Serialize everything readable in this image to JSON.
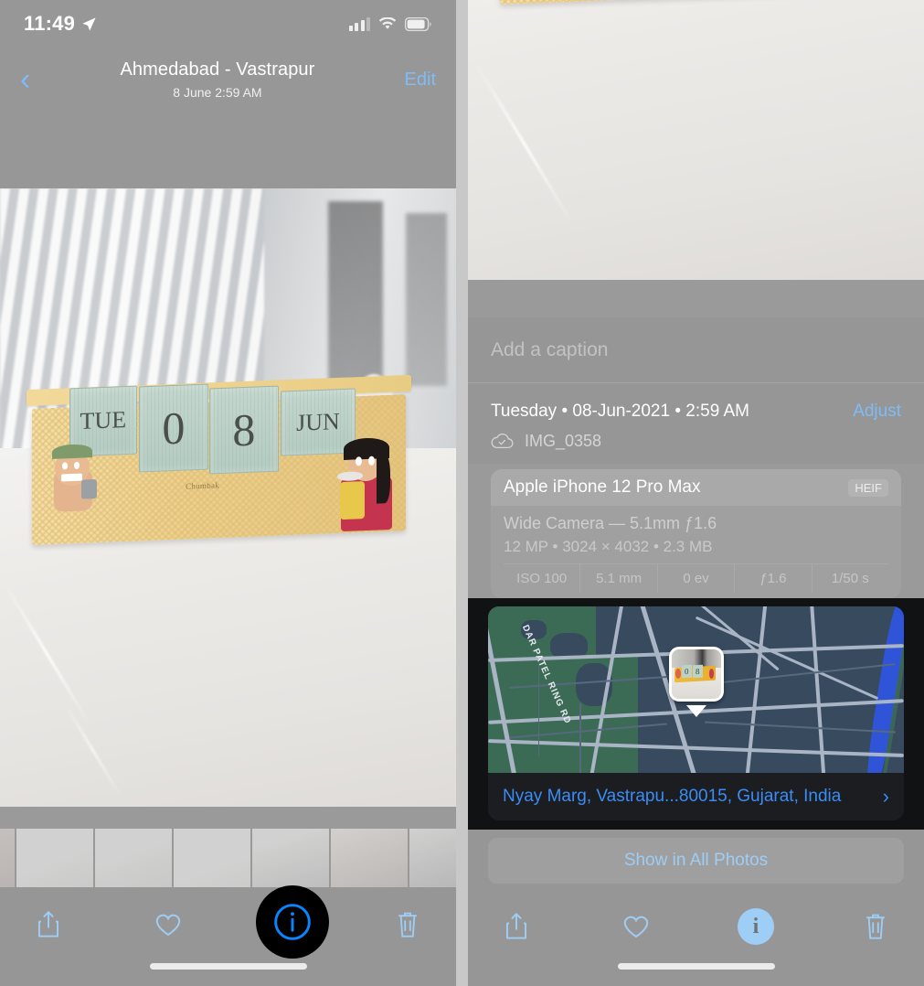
{
  "left": {
    "status": {
      "time": "11:49",
      "location_arrow": "location-arrow-icon",
      "signal": "cellular-signal-icon",
      "wifi": "wifi-icon",
      "battery": "battery-icon"
    },
    "nav": {
      "back": "chevron-left-icon",
      "title": "Ahmedabad - Vastrapur",
      "subtitle": "8 June  2:59 AM",
      "edit_label": "Edit"
    },
    "toolbar": {
      "share": "share-icon",
      "favorite": "heart-icon",
      "info": "info-icon",
      "delete": "trash-icon"
    },
    "photo": {
      "day": "TUE",
      "digit1": "0",
      "digit2": "8",
      "month": "JUN",
      "brand": "Chumbak"
    }
  },
  "right": {
    "caption": {
      "placeholder": "Add a caption",
      "value": ""
    },
    "meta": {
      "date_line": "Tuesday • 08-Jun-2021 • 2:59 AM",
      "adjust_label": "Adjust",
      "cloud_icon": "cloud-check-icon",
      "filename": "IMG_0358"
    },
    "exif": {
      "device": "Apple iPhone 12 Pro Max",
      "format": "HEIF",
      "lens_line": "Wide Camera — 5.1mm ƒ1.6",
      "size_line": "12 MP • 3024 × 4032 • 2.3 MB",
      "stats": [
        "ISO 100",
        "5.1 mm",
        "0 ev",
        "ƒ1.6",
        "1/50 s"
      ]
    },
    "map": {
      "road_label": "DAR PATEL RING RD",
      "address": "Nyay Marg, Vastrapu...80015, Gujarat, India",
      "chevron": "chevron-right-icon",
      "pin": "photo-pin-icon"
    },
    "show_all_label": "Show in All Photos",
    "toolbar": {
      "share": "share-icon",
      "favorite": "heart-icon",
      "info": "info-icon",
      "delete": "trash-icon"
    }
  },
  "colors": {
    "accent_blue": "#7fbcf5",
    "link_blue": "#3b8cf5",
    "overlay_gray": "#969696",
    "map_green": "#3b6b55",
    "map_blue_gray": "#374a5e",
    "river_blue": "#2f54d8",
    "sheet_dark": "#1b1d20"
  }
}
